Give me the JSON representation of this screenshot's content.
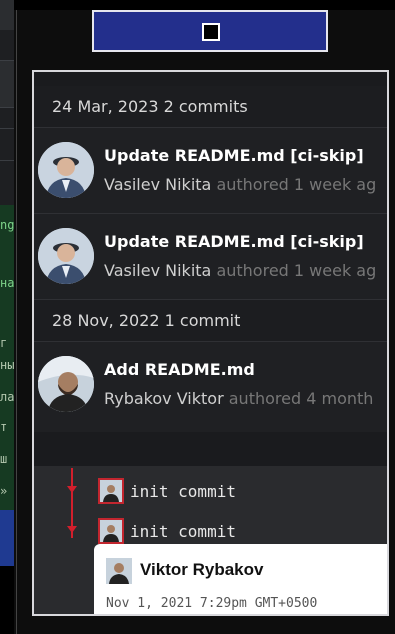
{
  "background": {
    "left_fragments": [
      "ng",
      "на",
      "г",
      "ны",
      "ла",
      "т",
      "ш",
      "»"
    ]
  },
  "toolbar": {
    "stop_icon": "stop-icon",
    "accent": "#232f8c"
  },
  "commits": {
    "groups": [
      {
        "date_label": "24 Mar, 2023 2 commits",
        "items": [
          {
            "title": "Update README.md [ci-skip]",
            "author": "Vasilev Nikita",
            "authored": "authored 1 week ag"
          },
          {
            "title": "Update README.md [ci-skip]",
            "author": "Vasilev Nikita",
            "authored": "authored 1 week ag"
          }
        ]
      },
      {
        "date_label": "28 Nov, 2022 1 commit",
        "items": [
          {
            "title": "Add README.md",
            "author": "Rybakov Viktor",
            "authored": "authored 4 month"
          }
        ]
      }
    ]
  },
  "graph": {
    "line_color": "#d21f2c",
    "commits": [
      {
        "message": "init commit"
      },
      {
        "message": "init commit"
      }
    ]
  },
  "tooltip": {
    "name": "Viktor Rybakov",
    "date": "Nov 1, 2021 7:29pm GMT+0500"
  }
}
